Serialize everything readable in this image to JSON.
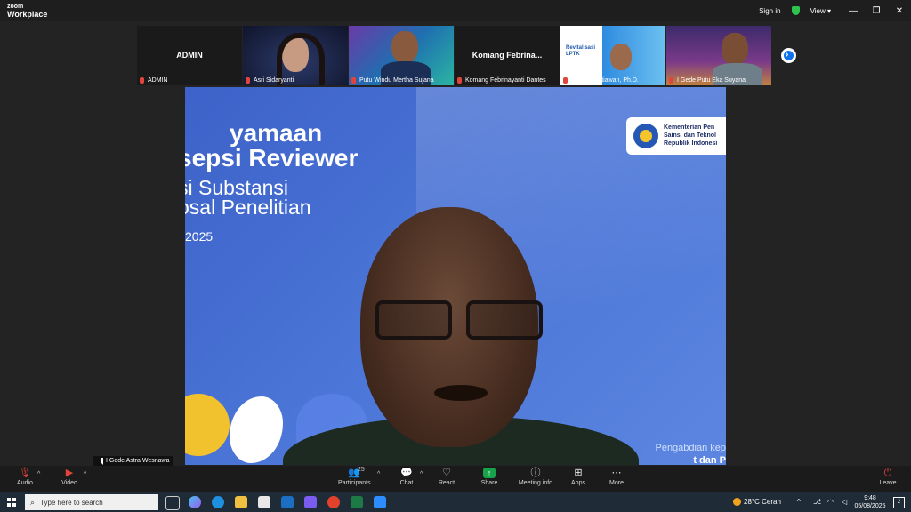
{
  "app": {
    "logo_line1": "zoom",
    "logo_line2": "Workplace",
    "sign_in": "Sign in",
    "view": "View ▾",
    "minimize": "—",
    "restore": "❐",
    "close": "✕"
  },
  "participants": [
    {
      "name": "ADMIN",
      "label": "ADMIN",
      "bg": "#1a1a1a"
    },
    {
      "name": "Asri Sidaryanti",
      "bg": "#1b2340"
    },
    {
      "name": "Putu Windu Mertha Sujana",
      "bg": "#2d3d7a"
    },
    {
      "name": "Komang Febrinayanti Dantes",
      "label": "Komang  Febrina...",
      "bg": "#1a1a1a"
    },
    {
      "name": "Indra Christiawan, Ph.D.",
      "bg": "#3c8ed9"
    },
    {
      "name": "I Gede Putu Eka Suyana",
      "bg": "#5a2f7a"
    }
  ],
  "slide": {
    "line1": "yamaan",
    "line2": "sepsi Reviewer",
    "line3": "si Substansi",
    "line4": "osal Penelitian",
    "year": "2025",
    "kemen_l1": "Kementerian Pen",
    "kemen_l2": "Sains, dan Teknol",
    "kemen_l3": "Republik Indonesi",
    "footer": "Pengabdian kep",
    "footer2": "t dan P"
  },
  "speaker": {
    "name": "I Gede Astra Wesnawa"
  },
  "controls": {
    "audio": "Audio",
    "video": "Video",
    "participants": "Participants",
    "participants_count": "25",
    "chat": "Chat",
    "react": "React",
    "share": "Share",
    "meeting_info": "Meeting info",
    "apps": "Apps",
    "more": "More",
    "leave": "Leave"
  },
  "taskbar": {
    "search_placeholder": "Type here to search",
    "weather": "28°C  Cerah",
    "time": "9:48",
    "date": "05/08/2025",
    "notif": "2"
  },
  "colors": {
    "zoom_blue": "#0e72ed",
    "slide_blue": "#4a74d6",
    "share_green": "#17a34a",
    "mic_red": "#e0453a"
  }
}
